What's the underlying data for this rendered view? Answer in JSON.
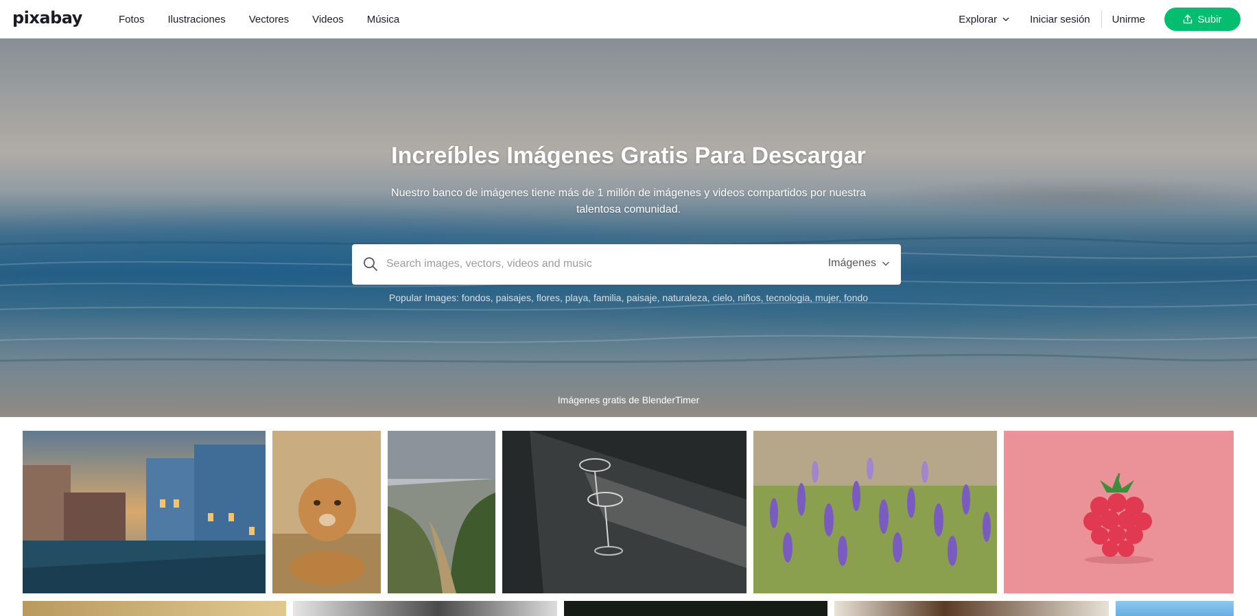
{
  "header": {
    "logo": "pixabay",
    "nav": [
      "Fotos",
      "Ilustraciones",
      "Vectores",
      "Videos",
      "Música"
    ],
    "explore": "Explorar",
    "login": "Iniciar sesión",
    "join": "Unirme",
    "upload": "Subir"
  },
  "hero": {
    "title": "Increíbles Imágenes Gratis Para Descargar",
    "subtitle": "Nuestro banco de imágenes tiene más de 1 millón de imágenes y videos compartidos por nuestra talentosa comunidad.",
    "search_placeholder": "Search images, vectors, videos and music",
    "search_value": "",
    "type_selected": "Imágenes",
    "popular_label": "Popular Images:",
    "popular_tags": [
      "fondos",
      "paisajes",
      "flores",
      "playa",
      "familia",
      "paisaje",
      "naturaleza",
      "cielo",
      "niños",
      "tecnologia",
      "mujer",
      "fondo"
    ],
    "credit": "Imágenes gratis de BlenderTimer"
  },
  "gallery": {
    "row1": [
      {
        "subject": "venice-canal"
      },
      {
        "subject": "lion-cub"
      },
      {
        "subject": "mountain-valley"
      },
      {
        "subject": "glasses-table"
      },
      {
        "subject": "lavender-field"
      },
      {
        "subject": "raspberry"
      }
    ]
  },
  "colors": {
    "accent": "#02be6e",
    "text": "#191b26"
  }
}
